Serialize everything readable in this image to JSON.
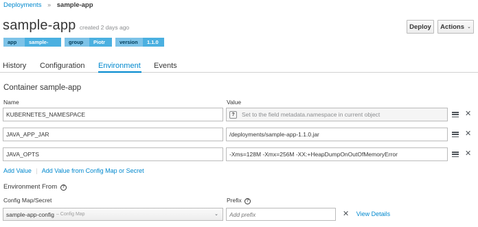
{
  "breadcrumb": {
    "parent": "Deployments",
    "separator": "»",
    "current": "sample-app"
  },
  "header": {
    "title": "sample-app",
    "created": "created 2 days ago",
    "deploy_label": "Deploy",
    "actions_label": "Actions",
    "actions_caret": "⌄"
  },
  "labels": [
    {
      "key": "app",
      "value": "sample-app"
    },
    {
      "key": "group",
      "value": "Piotr"
    },
    {
      "key": "version",
      "value": "1.1.0"
    }
  ],
  "tabs": [
    {
      "label": "History",
      "active": false
    },
    {
      "label": "Configuration",
      "active": false
    },
    {
      "label": "Environment",
      "active": true
    },
    {
      "label": "Events",
      "active": false
    }
  ],
  "section": {
    "title": "Container sample-app",
    "name_header": "Name",
    "value_header": "Value"
  },
  "env_vars": [
    {
      "name": "KUBERNETES_NAMESPACE",
      "value": "Set to the field metadata.namespace in current object",
      "disabled": true,
      "help_icon": "?"
    },
    {
      "name": "JAVA_APP_JAR",
      "value": "/deployments/sample-app-1.1.0.jar",
      "disabled": false
    },
    {
      "name": "JAVA_OPTS",
      "value": "-Xms=128M -Xmx=256M -XX:+HeapDumpOnOutOfMemoryError",
      "disabled": false
    }
  ],
  "row_icons": {
    "drag": "drag-handle-icon",
    "remove": "close-icon",
    "remove_glyph": "✕"
  },
  "actions": {
    "add_value": "Add Value",
    "separator": "|",
    "add_from_config": "Add Value from Config Map or Secret"
  },
  "env_from": {
    "title": "Environment From",
    "help_glyph": "?",
    "config_header": "Config Map/Secret",
    "prefix_header": "Prefix",
    "selected_config": "sample-app-config",
    "selected_type": "– Config Map",
    "select_arrow": "⌄",
    "prefix_placeholder": "Add prefix",
    "remove_glyph": "✕",
    "view_details": "View Details"
  },
  "colors": {
    "accent": "#0088ce",
    "label_key": "#7dc3e8",
    "label_value": "#4bb0e0"
  }
}
